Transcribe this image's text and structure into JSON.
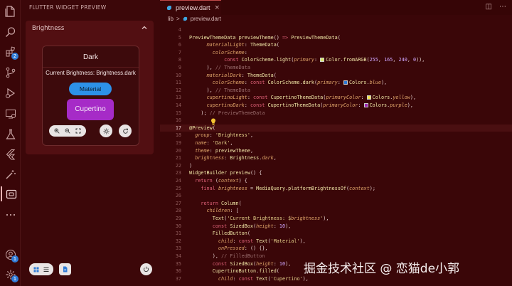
{
  "activity_bar": {
    "items": [
      {
        "icon": "files-icon"
      },
      {
        "icon": "search-icon"
      },
      {
        "icon": "extensions-icon",
        "badge": "2"
      },
      {
        "icon": "source-control-icon"
      },
      {
        "icon": "run-debug-icon"
      },
      {
        "icon": "remote-explorer-icon"
      },
      {
        "icon": "testing-icon"
      },
      {
        "icon": "flutter-icon"
      },
      {
        "icon": "wand-icon"
      },
      {
        "icon": "flutter-preview-icon",
        "active": true
      },
      {
        "icon": "more-icon"
      },
      {
        "icon": "account-icon",
        "badge": "1"
      },
      {
        "icon": "settings-gear-icon",
        "badge": "1"
      }
    ]
  },
  "side_panel": {
    "title": "FLUTTER WIDGET PREVIEW",
    "section": {
      "label": "Brightness",
      "card": {
        "title": "Dark",
        "text": "Current Brightness: Brightness.dark",
        "material_button": "Material",
        "cupertino_button": "Cupertino"
      }
    }
  },
  "editor": {
    "tab": {
      "label": "preview.dart",
      "close": "×"
    },
    "breadcrumb": {
      "folder": "lib",
      "sep": ">",
      "file": "preview.dart"
    },
    "current_line": 17,
    "lines": [
      {
        "n": "4",
        "html": ""
      },
      {
        "n": "5",
        "html": "<span class='t'>PreviewThemeData</span> <span class='f'>previewTheme</span>() <span class='k'>=&gt;</span> <span class='t'>PreviewThemeData</span>("
      },
      {
        "n": "6",
        "html": "      <span class='v'>materialLight</span>: <span class='t'>ThemeData</span>("
      },
      {
        "n": "7",
        "html": "        <span class='v'>colorScheme</span>:"
      },
      {
        "n": "8",
        "html": "            <span class='k'>const</span> <span class='t'>ColorScheme</span>.<span class='f'>light</span>(<span class='v'>primary</span>: <span class='sw' style='background:#d8e66a'></span><span class='t'>Color</span>.<span class='f'>fromARGB</span>(<span class='n'>255</span>, <span class='n'>165</span>, <span class='n'>240</span>, <span class='n'>0</span>)),"
      },
      {
        "n": "9",
        "html": "      ), <span class='c'>// ThemeData</span>"
      },
      {
        "n": "10",
        "html": "      <span class='v'>materialDark</span>: <span class='t'>ThemeData</span>("
      },
      {
        "n": "11",
        "html": "        <span class='v'>colorScheme</span>: <span class='k'>const</span> <span class='t'>ColorScheme</span>.<span class='f'>dark</span>(<span class='v'>primary</span>: <span class='sw' style='background:#2f7ad6'></span><span class='t'>Colors</span>.<span class='v'>blue</span>),"
      },
      {
        "n": "12",
        "html": "      ), <span class='c'>// ThemeData</span>"
      },
      {
        "n": "13",
        "html": "      <span class='v'>cupertinoLight</span>: <span class='k'>const</span> <span class='t'>CupertinoThemeData</span>(<span class='v'>primaryColor</span>: <span class='sw' style='background:#f2e04a'></span><span class='t'>Colors</span>.<span class='v'>yellow</span>),"
      },
      {
        "n": "14",
        "html": "      <span class='v'>cupertinoDark</span>: <span class='k'>const</span> <span class='t'>CupertinoThemeData</span>(<span class='v'>primaryColor</span>: <span class='sw' style='background:#9c27b0'></span><span class='t'>Colors</span>.<span class='v'>purple</span>),"
      },
      {
        "n": "15",
        "html": "    ); <span class='c'>// PreviewThemeData</span>"
      },
      {
        "n": "16",
        "html": ""
      },
      {
        "n": "17",
        "html": "<span class='t'>@Preview</span>("
      },
      {
        "n": "18",
        "html": "  <span class='v'>group</span>: <span class='s'>'Brightness'</span>,"
      },
      {
        "n": "19",
        "html": "  <span class='v'>name</span>: <span class='s'>'Dark'</span>,"
      },
      {
        "n": "20",
        "html": "  <span class='v'>theme</span>: <span class='f'>previewTheme</span>,"
      },
      {
        "n": "21",
        "html": "  <span class='v'>brightness</span>: <span class='t'>Brightness</span>.<span class='v'>dark</span>,"
      },
      {
        "n": "22",
        "html": ")"
      },
      {
        "n": "23",
        "html": "<span class='t'>WidgetBuilder</span> <span class='f'>preview</span>() {"
      },
      {
        "n": "24",
        "html": "  <span class='k'>return</span> (<span class='v'>context</span>) {"
      },
      {
        "n": "25",
        "html": "    <span class='k'>final</span> <span class='v'>brightness</span> = <span class='t'>MediaQuery</span>.<span class='f'>platformBrightnessOf</span>(<span class='v'>context</span>);"
      },
      {
        "n": "26",
        "html": ""
      },
      {
        "n": "27",
        "html": "    <span class='k'>return</span> <span class='t'>Column</span>("
      },
      {
        "n": "28",
        "html": "      <span class='v'>children</span>: ["
      },
      {
        "n": "29",
        "html": "        <span class='t'>Text</span>(<span class='s'>'Current Brightness: $<span class='v'>brightness</span>'</span>),"
      },
      {
        "n": "30",
        "html": "        <span class='k'>const</span> <span class='t'>SizedBox</span>(<span class='v'>height</span>: <span class='n'>10</span>),"
      },
      {
        "n": "31",
        "html": "        <span class='t'>FilledButton</span>("
      },
      {
        "n": "32",
        "html": "          <span class='v'>child</span>: <span class='k'>const</span> <span class='t'>Text</span>(<span class='s'>'Material'</span>),"
      },
      {
        "n": "33",
        "html": "          <span class='v'>onPressed</span>: () {},"
      },
      {
        "n": "34",
        "html": "        ), <span class='c'>// FilledButton</span>"
      },
      {
        "n": "35",
        "html": "        <span class='k'>const</span> <span class='t'>SizedBox</span>(<span class='v'>height</span>: <span class='n'>10</span>),"
      },
      {
        "n": "36",
        "html": "        <span class='t'>CupertinoButton</span>.<span class='f'>filled</span>("
      },
      {
        "n": "37",
        "html": "          <span class='v'>child</span>: <span class='k'>const</span> <span class='t'>Text</span>(<span class='s'>'Cupertino'</span>),"
      }
    ]
  },
  "watermark": "掘金技术社区 @ 恋猫de小郭",
  "colors": {
    "background": "#3a0608",
    "panel": "#3c0709",
    "section": "#520f12",
    "material_button": "#2d91e8",
    "cupertino_button": "#a62bc7"
  }
}
